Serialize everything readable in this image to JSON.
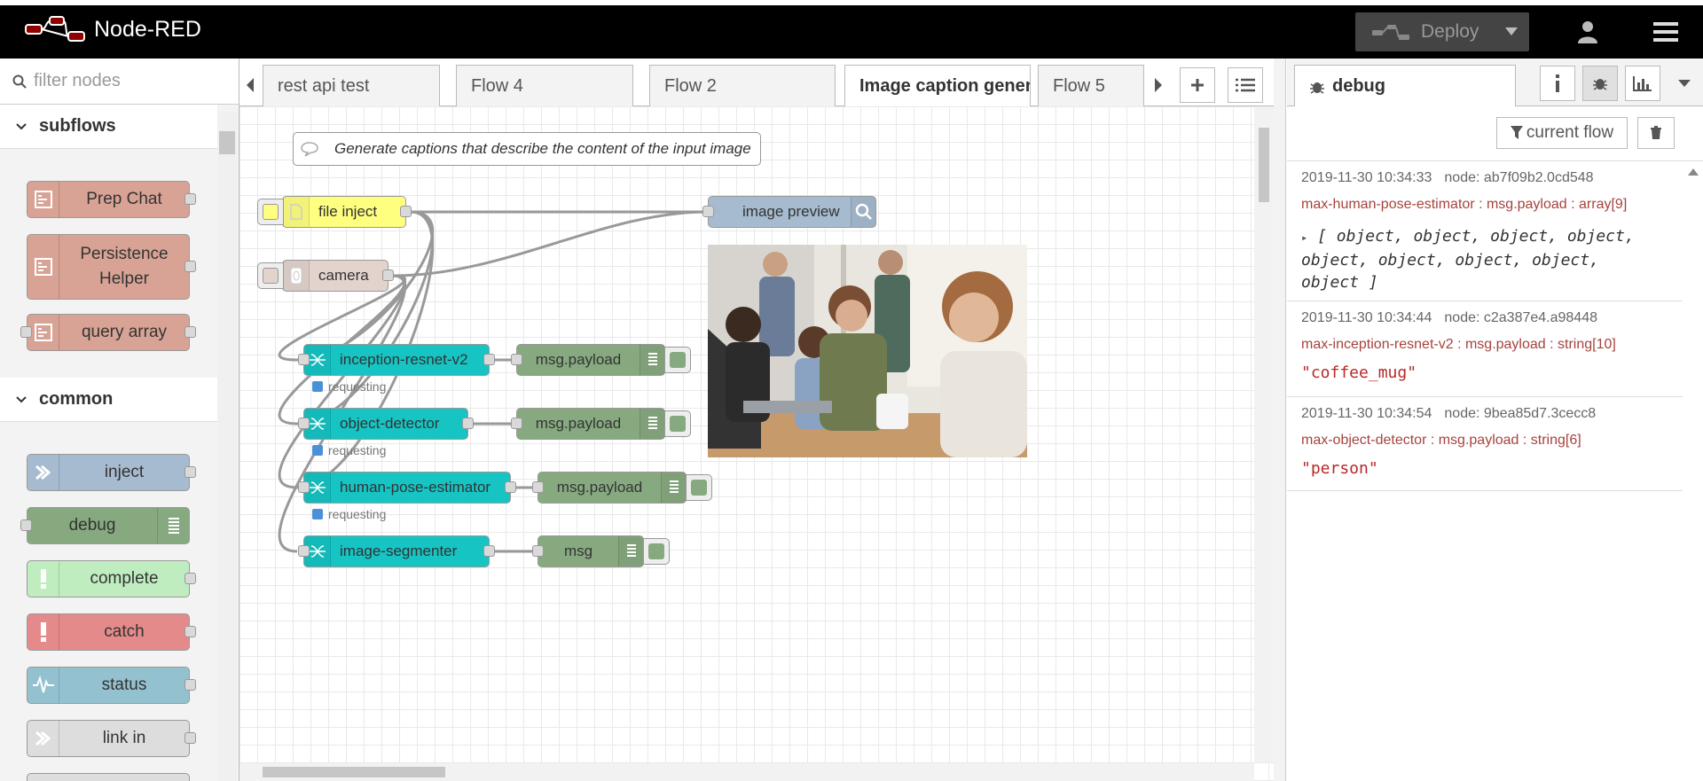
{
  "header": {
    "app_title": "Node-RED",
    "deploy_label": "Deploy",
    "icons": [
      "node-red-logo-icon",
      "deploy-icon",
      "chevron-down-icon",
      "user-icon",
      "menu-icon"
    ]
  },
  "palette": {
    "search_placeholder": "filter nodes",
    "categories": [
      {
        "label": "subflows",
        "nodes": [
          "Prep Chat",
          "Persistence Helper",
          "query array"
        ]
      },
      {
        "label": "common",
        "nodes": [
          "inject",
          "debug",
          "complete",
          "catch",
          "status",
          "link in"
        ]
      }
    ],
    "colors": {
      "subflow": "#d8a394",
      "inject": "#a6bbcf",
      "debug": "#87a980",
      "complete": "#c0edc0",
      "catch": "#e48a8a",
      "status": "#94c1d0",
      "link": "#dddddd"
    }
  },
  "tabs": {
    "items": [
      "rest api test",
      "Flow 4",
      "Flow 2",
      "Image caption generator",
      "Flow 5"
    ],
    "active": "Image caption generator"
  },
  "flow": {
    "comment": "Generate captions that describe the content of the input image",
    "nodes": {
      "file_inject": "file inject",
      "camera": "camera",
      "image_preview": "image preview",
      "inception": "inception-resnet-v2",
      "object_detector": "object-detector",
      "pose": "human-pose-estimator",
      "segmenter": "image-segmenter",
      "debug1": "msg.payload",
      "debug2": "msg.payload",
      "debug3": "msg.payload",
      "debug4": "msg"
    },
    "status_text": "requesting",
    "colors": {
      "inject_yellow": "#ffff7f",
      "camera": "#e2d3cd",
      "preview": "#a6bbcf",
      "max": "#16c4c4",
      "debug": "#87a980"
    }
  },
  "sidebar": {
    "tab_label": "debug",
    "filter_label": "current flow",
    "messages": [
      {
        "time": "2019-11-30 10:34:33",
        "node": "node: ab7f09b2.0cd548",
        "topic": "max-human-pose-estimator : msg.payload : array[9]",
        "value_line1": "[ object, object, object, object,",
        "value_line2": "object, object, object, object,",
        "value_line3": "object ]"
      },
      {
        "time": "2019-11-30 10:34:44",
        "node": "node: c2a387e4.a98448",
        "topic": "max-inception-resnet-v2 : msg.payload : string[10]",
        "value": "\"coffee_mug\""
      },
      {
        "time": "2019-11-30 10:34:54",
        "node": "node: 9bea85d7.3cecc8",
        "topic": "max-object-detector : msg.payload : string[6]",
        "value": "\"person\""
      }
    ]
  }
}
